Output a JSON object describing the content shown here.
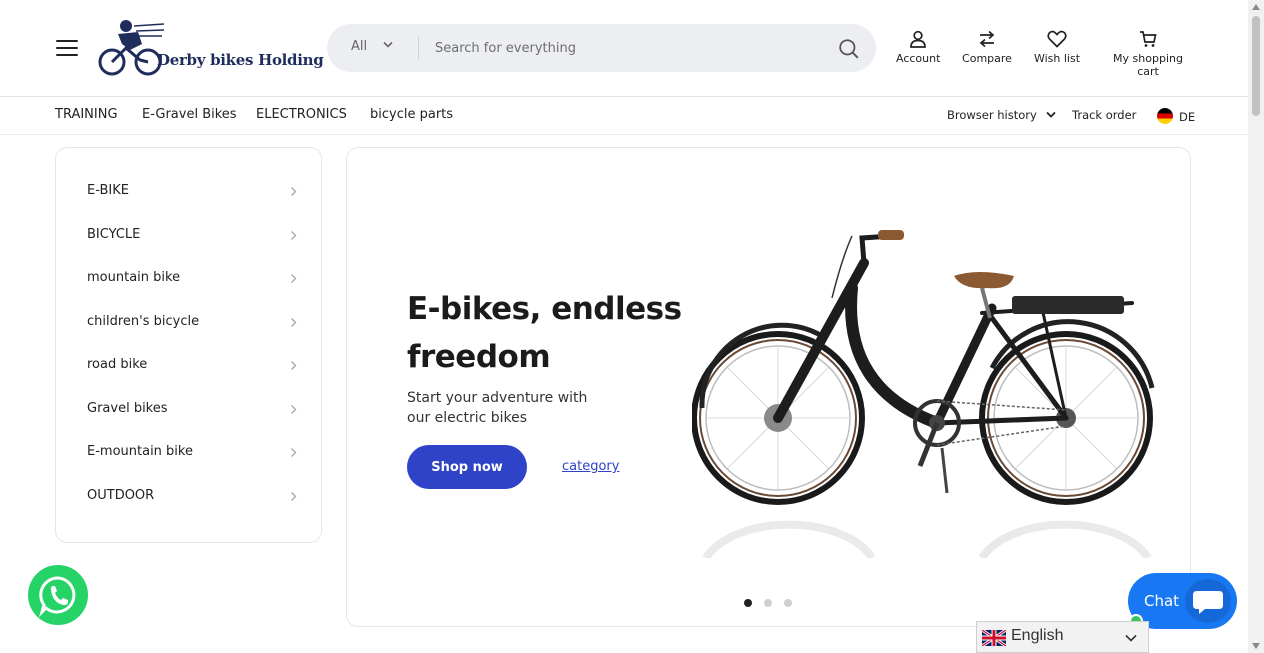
{
  "header": {
    "logo_text": "Derby bikes Holding",
    "search": {
      "category": "All",
      "placeholder": "Search for everything"
    },
    "actions": [
      {
        "label": "Account",
        "icon": "user-icon"
      },
      {
        "label": "Compare",
        "icon": "compare-arrows-icon"
      },
      {
        "label": "Wish list",
        "icon": "heart-icon"
      },
      {
        "label": "My shopping cart",
        "icon": "cart-icon"
      }
    ]
  },
  "nav": {
    "items": [
      "TRAINING",
      "E-Gravel Bikes",
      "ELECTRONICS",
      "bicycle parts"
    ],
    "browser_history": "Browser history",
    "track_order": "Track order",
    "language": "DE"
  },
  "sidebar": {
    "items": [
      "E-BIKE",
      "BICYCLE",
      "mountain bike",
      "children's bicycle",
      "road bike",
      "Gravel bikes",
      "E-mountain bike",
      "OUTDOOR"
    ]
  },
  "hero": {
    "title": "E-bikes, endless freedom",
    "subtitle": "Start your adventure with our electric bikes",
    "primary_button": "Shop now",
    "secondary_link": "category",
    "slides": 3,
    "active_slide": 1
  },
  "widgets": {
    "chat_label": "Chat",
    "language_select": "English"
  },
  "colors": {
    "accent": "#2f43c8",
    "search_bg": "#eceef2",
    "whatsapp": "#25d366",
    "chat": "#1877f2"
  }
}
